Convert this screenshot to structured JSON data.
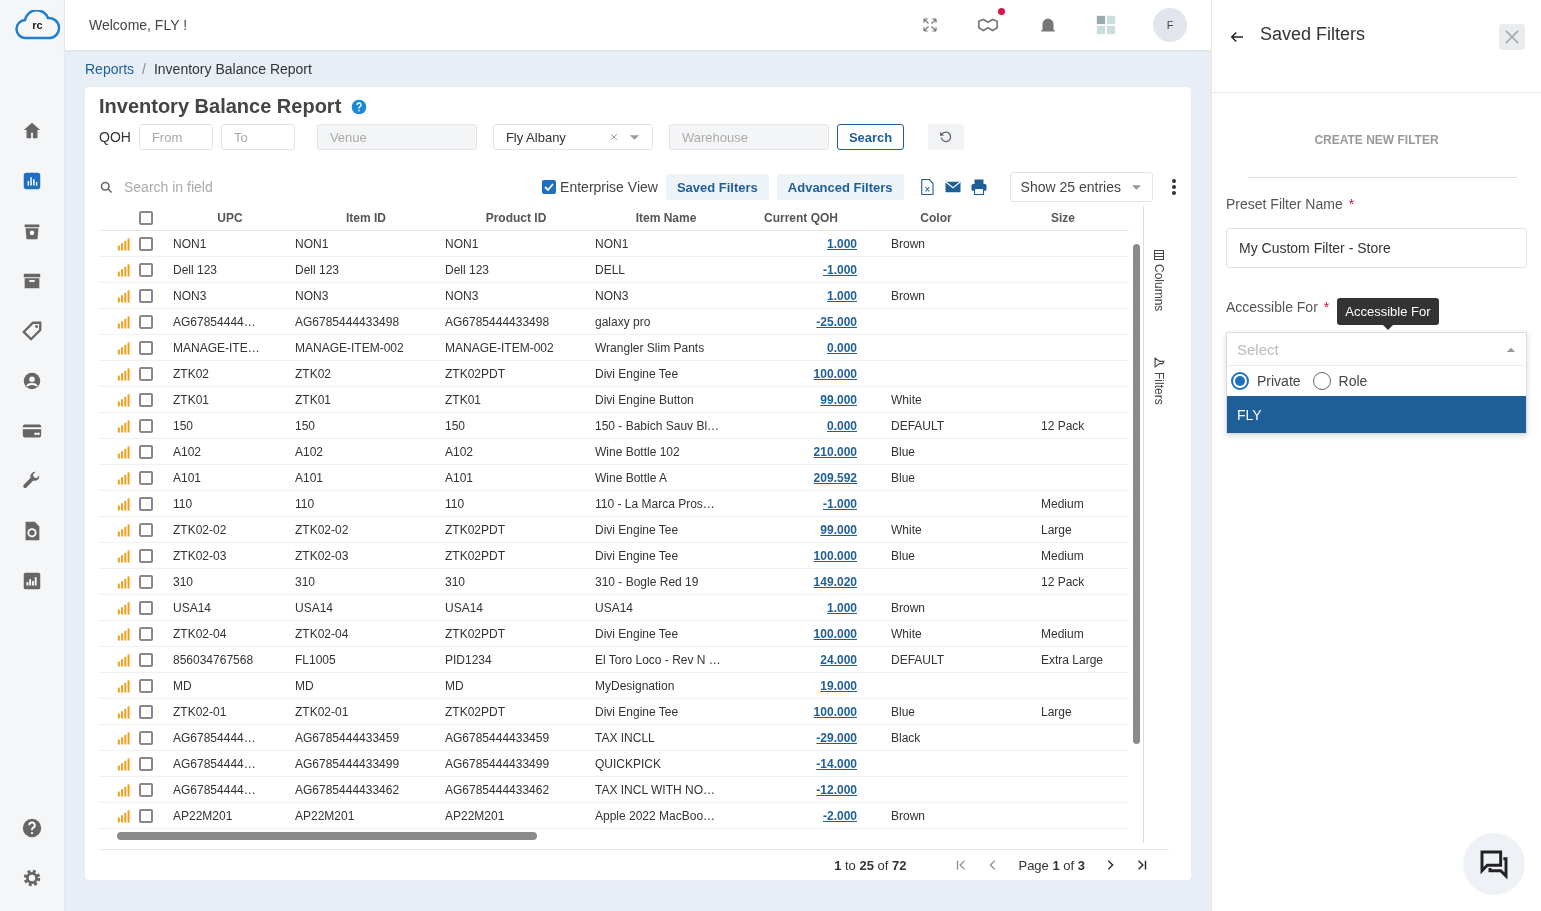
{
  "header": {
    "welcome": "Welcome, FLY !",
    "logo": "rc",
    "avatar": "F",
    "notification_dot": true
  },
  "sidebar": {
    "items": [
      {
        "selected": false
      },
      {
        "selected": true
      },
      {
        "selected": false
      },
      {
        "selected": false
      },
      {
        "selected": false
      },
      {
        "selected": false
      },
      {
        "selected": false
      },
      {
        "selected": false
      },
      {
        "selected": false
      },
      {
        "selected": false
      }
    ]
  },
  "breadcrumb": {
    "items": [
      "Reports",
      "Inventory Balance Report"
    ],
    "separator": "/"
  },
  "report": {
    "title": "Inventory Balance Report",
    "filters": {
      "qoh_label": "QOH",
      "from": {
        "placeholder": "From"
      },
      "to": {
        "placeholder": "To"
      },
      "venue": {
        "placeholder": "Venue"
      },
      "store": {
        "value": "Fly Albany"
      },
      "warehouse": {
        "placeholder": "Warehouse"
      },
      "search_button": "Search"
    },
    "toolbar": {
      "search": {
        "placeholder": "Search in field"
      },
      "enterprise_view": {
        "label": "Enterprise View",
        "checked": true
      },
      "buttons": [
        "Saved Filters",
        "Advanced Filters"
      ],
      "page_size": "Show 25 entries"
    },
    "table": {
      "select_all_checked": false,
      "columns": [
        "UPC",
        "Item ID",
        "Product ID",
        "Item Name",
        "Current QOH",
        "Color",
        "Size"
      ],
      "rows": [
        {
          "checked": false,
          "upc": "NON1",
          "item_id": "NON1",
          "product_id": "NON1",
          "item_name": "NON1",
          "current_qoh": "1.000",
          "item_color": "Brown"
        },
        {
          "checked": false,
          "upc": "Dell 123",
          "item_id": "Dell 123",
          "product_id": "Dell 123",
          "item_name": "DELL",
          "current_qoh": "-1.000"
        },
        {
          "checked": false,
          "upc": "NON3",
          "item_id": "NON3",
          "product_id": "NON3",
          "item_name": "NON3",
          "current_qoh": "1.000",
          "item_color": "Brown"
        },
        {
          "checked": false,
          "upc": "AG67854444…",
          "item_id": "AG6785444433498",
          "product_id": "AG6785444433498",
          "item_name": "galaxy pro",
          "current_qoh": "-25.000"
        },
        {
          "checked": false,
          "upc": "MANAGE-ITE…",
          "item_id": "MANAGE-ITEM-002",
          "product_id": "MANAGE-ITEM-002",
          "item_name": "Wrangler Slim Pants",
          "current_qoh": "0.000"
        },
        {
          "checked": false,
          "upc": "ZTK02",
          "item_id": "ZTK02",
          "product_id": "ZTK02PDT",
          "item_name": "Divi Engine Tee",
          "current_qoh": "100.000"
        },
        {
          "checked": false,
          "upc": "ZTK01",
          "item_id": "ZTK01",
          "product_id": "ZTK01",
          "item_name": "Divi Engine Button",
          "current_qoh": "99.000",
          "item_color": "White"
        },
        {
          "checked": false,
          "upc": "150",
          "item_id": "150",
          "product_id": "150",
          "item_name": "150 - Babich Sauv Bl…",
          "current_qoh": "0.000",
          "item_color": "DEFAULT",
          "size": "12 Pack"
        },
        {
          "checked": false,
          "upc": "A102",
          "item_id": "A102",
          "product_id": "A102",
          "item_name": "Wine Bottle 102",
          "current_qoh": "210.000",
          "item_color": "Blue"
        },
        {
          "checked": false,
          "upc": "A101",
          "item_id": "A101",
          "product_id": "A101",
          "item_name": "Wine Bottle A",
          "current_qoh": "209.592",
          "item_color": "Blue"
        },
        {
          "checked": false,
          "upc": "110",
          "item_id": "110",
          "product_id": "110",
          "item_name": "110 - La Marca Pros…",
          "current_qoh": "-1.000",
          "size": "Medium"
        },
        {
          "checked": false,
          "upc": "ZTK02-02",
          "item_id": "ZTK02-02",
          "product_id": "ZTK02PDT",
          "item_name": "Divi Engine Tee",
          "current_qoh": "99.000",
          "item_color": "White",
          "size": "Large"
        },
        {
          "checked": false,
          "upc": "ZTK02-03",
          "item_id": "ZTK02-03",
          "product_id": "ZTK02PDT",
          "item_name": "Divi Engine Tee",
          "current_qoh": "100.000",
          "item_color": "Blue",
          "size": "Medium"
        },
        {
          "checked": false,
          "upc": "310",
          "item_id": "310",
          "product_id": "310",
          "item_name": "310 - Bogle Red 19",
          "current_qoh": "149.020",
          "size": "12 Pack"
        },
        {
          "checked": false,
          "upc": "USA14",
          "item_id": "USA14",
          "product_id": "USA14",
          "item_name": "USA14",
          "current_qoh": "1.000",
          "item_color": "Brown"
        },
        {
          "checked": false,
          "upc": "ZTK02-04",
          "item_id": "ZTK02-04",
          "product_id": "ZTK02PDT",
          "item_name": "Divi Engine Tee",
          "current_qoh": "100.000",
          "item_color": "White",
          "size": "Medium"
        },
        {
          "checked": false,
          "upc": "856034767568",
          "item_id": "FL1005",
          "product_id": "PID1234",
          "item_name": "El Toro Loco - Rev N …",
          "current_qoh": "24.000",
          "item_color": "DEFAULT",
          "size": "Extra Large"
        },
        {
          "checked": false,
          "upc": "MD",
          "item_id": "MD",
          "product_id": "MD",
          "item_name": "MyDesignation",
          "current_qoh": "19.000"
        },
        {
          "checked": false,
          "upc": "ZTK02-01",
          "item_id": "ZTK02-01",
          "product_id": "ZTK02PDT",
          "item_name": "Divi Engine Tee",
          "current_qoh": "100.000",
          "item_color": "Blue",
          "size": "Large"
        },
        {
          "checked": false,
          "upc": "AG67854444…",
          "item_id": "AG6785444433459",
          "product_id": "AG6785444433459",
          "item_name": "TAX INCLL",
          "current_qoh": "-29.000",
          "item_color": "Black"
        },
        {
          "checked": false,
          "upc": "AG67854444…",
          "item_id": "AG6785444433499",
          "product_id": "AG6785444433499",
          "item_name": "QUICKPICK",
          "current_qoh": "-14.000"
        },
        {
          "checked": false,
          "upc": "AG67854444…",
          "item_id": "AG6785444433462",
          "product_id": "AG6785444433462",
          "item_name": "TAX INCL WITH NO…",
          "current_qoh": "-12.000"
        },
        {
          "checked": false,
          "upc": "AP22M201",
          "item_id": "AP22M201",
          "product_id": "AP22M201",
          "item_name": "Apple 2022 MacBoo…",
          "current_qoh": "-2.000",
          "item_color": "Brown"
        }
      ]
    },
    "side_tabs": [
      "Columns",
      "Filters"
    ],
    "pagination": {
      "summary": "**1** to **25** of **72**",
      "page": "Page **1** of **3**"
    }
  },
  "panel": {
    "title": "Saved Filters",
    "section": "CREATE NEW FILTER",
    "preset_name": {
      "label": "Preset Filter Name",
      "required_mark": "*",
      "value": "My Custom Filter - Store"
    },
    "accessible_for": {
      "label": "Accessible For",
      "required_mark": "*",
      "tooltip": "Accessible For",
      "placeholder": "Select",
      "radios": [
        {
          "label": "Private",
          "selected": true
        },
        {
          "label": "Role",
          "selected": false
        }
      ],
      "options": [
        {
          "label": "FLY",
          "selected": true
        }
      ]
    }
  }
}
